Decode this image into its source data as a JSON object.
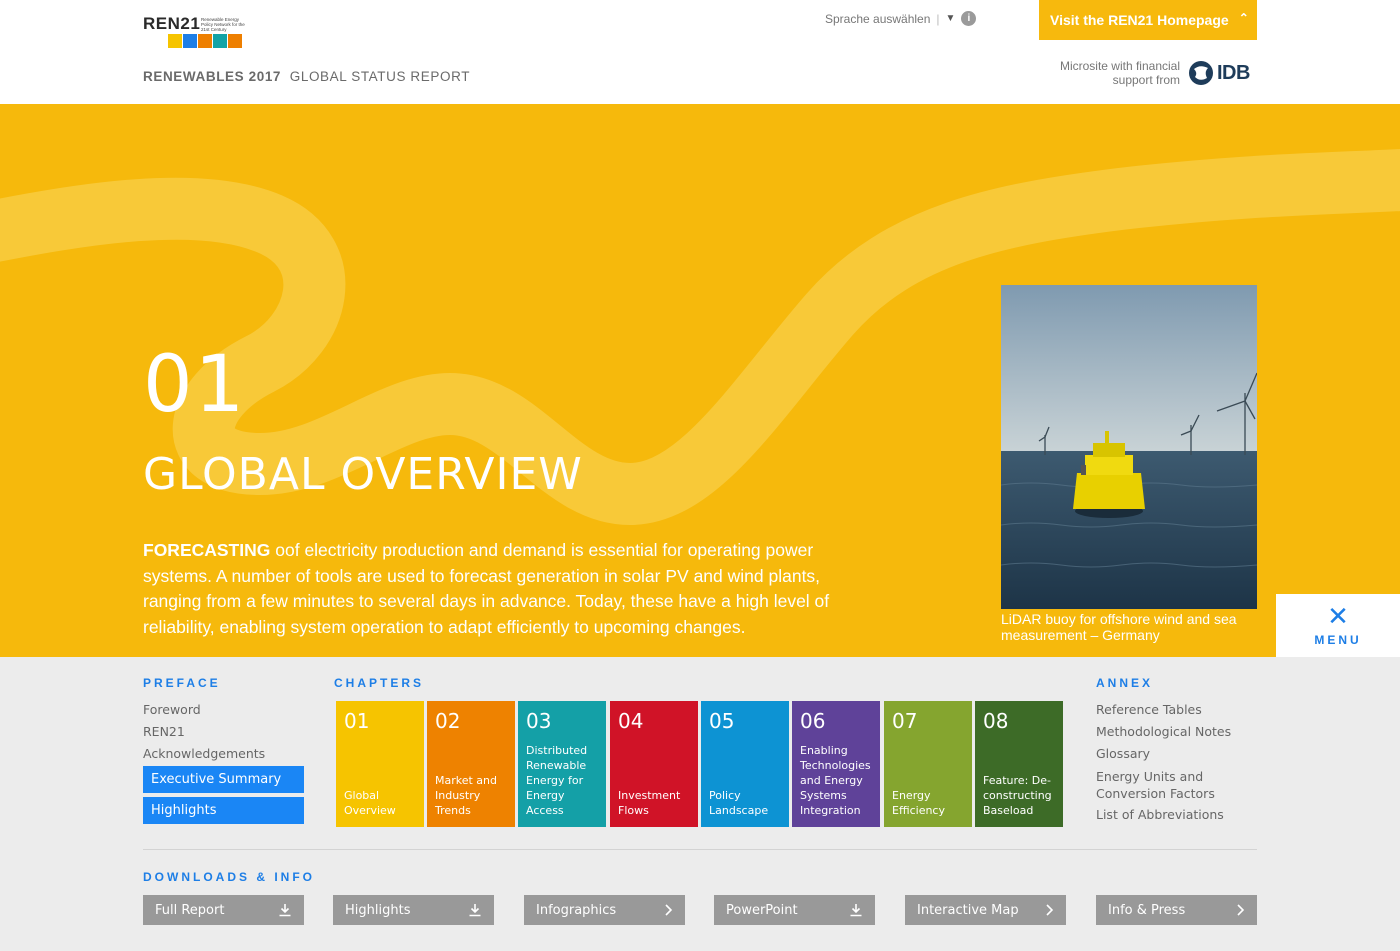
{
  "header": {
    "logo_word": "REN21",
    "logo_tag": "Renewable Energy Policy Network for the 21st Century",
    "logo_colors": [
      "#f6c400",
      "#1d7ee6",
      "#ee7f00",
      "#13a3a6",
      "#ee7f00"
    ],
    "report_year": "RENEWABLES 2017",
    "report_name": "GLOBAL STATUS REPORT",
    "language_label": "Sprache auswählen",
    "language_separator": "|",
    "language_arrow": "▼",
    "info_icon": "i",
    "visit_label": "Visit the REN21 Homepage",
    "visit_chevron": "⌃",
    "sponsor_line1": "Microsite with financial",
    "sponsor_line2": "support from",
    "sponsor_name": "IDB"
  },
  "hero": {
    "chapter_number": "01",
    "chapter_title": "GLOBAL OVERVIEW",
    "text_bold": "FORECASTING",
    "text_body": "oof electricity production and demand is essential for operating power systems. A number of tools are used to forecast generation in solar PV and wind plants, ranging from a few minutes to several days in advance. Today, these have a high level of reliability, enabling system operation to adapt efficiently to upcoming changes.",
    "photo_caption": "LiDAR buoy for offshore wind and sea measurement – Germany",
    "accent_color": "#f6b90c"
  },
  "menu": {
    "close_glyph": "✕",
    "label": "MENU"
  },
  "nav": {
    "preface": {
      "heading": "PREFACE",
      "links": [
        "Foreword",
        "REN21",
        "Acknowledgements"
      ],
      "highlighted": [
        "Executive Summary",
        "Highlights"
      ]
    },
    "chapters": {
      "heading": "CHAPTERS",
      "items": [
        {
          "num": "01",
          "name": "Global Overview",
          "color": "#f6c400"
        },
        {
          "num": "02",
          "name": "Market and Industry Trends",
          "color": "#ee8200"
        },
        {
          "num": "03",
          "name": "Distributed Renewable Energy for Energy Access",
          "color": "#14a0a7"
        },
        {
          "num": "04",
          "name": "Investment Flows",
          "color": "#d01327"
        },
        {
          "num": "05",
          "name": "Policy Landscape",
          "color": "#0d93d3"
        },
        {
          "num": "06",
          "name": "Enabling Technologies and Energy Systems Integration",
          "color": "#5f4299"
        },
        {
          "num": "07",
          "name": "Energy Efficiency",
          "color": "#85a52f"
        },
        {
          "num": "08",
          "name": "Feature: De-constructing Baseload",
          "color": "#3d6b27"
        }
      ]
    },
    "annex": {
      "heading": "ANNEX",
      "links": [
        "Reference Tables",
        "Methodological Notes",
        "Glossary",
        "Energy Units and Conversion Factors",
        "List of Abbreviations"
      ]
    },
    "downloads": {
      "heading": "DOWNLOADS & INFO",
      "buttons": [
        {
          "label": "Full Report",
          "icon": "download-icon"
        },
        {
          "label": "Highlights",
          "icon": "download-icon"
        },
        {
          "label": "Infographics",
          "icon": "chevron-right-icon"
        },
        {
          "label": "PowerPoint",
          "icon": "download-icon"
        },
        {
          "label": "Interactive Map",
          "icon": "chevron-right-icon"
        },
        {
          "label": "Info & Press",
          "icon": "chevron-right-icon"
        }
      ]
    }
  }
}
